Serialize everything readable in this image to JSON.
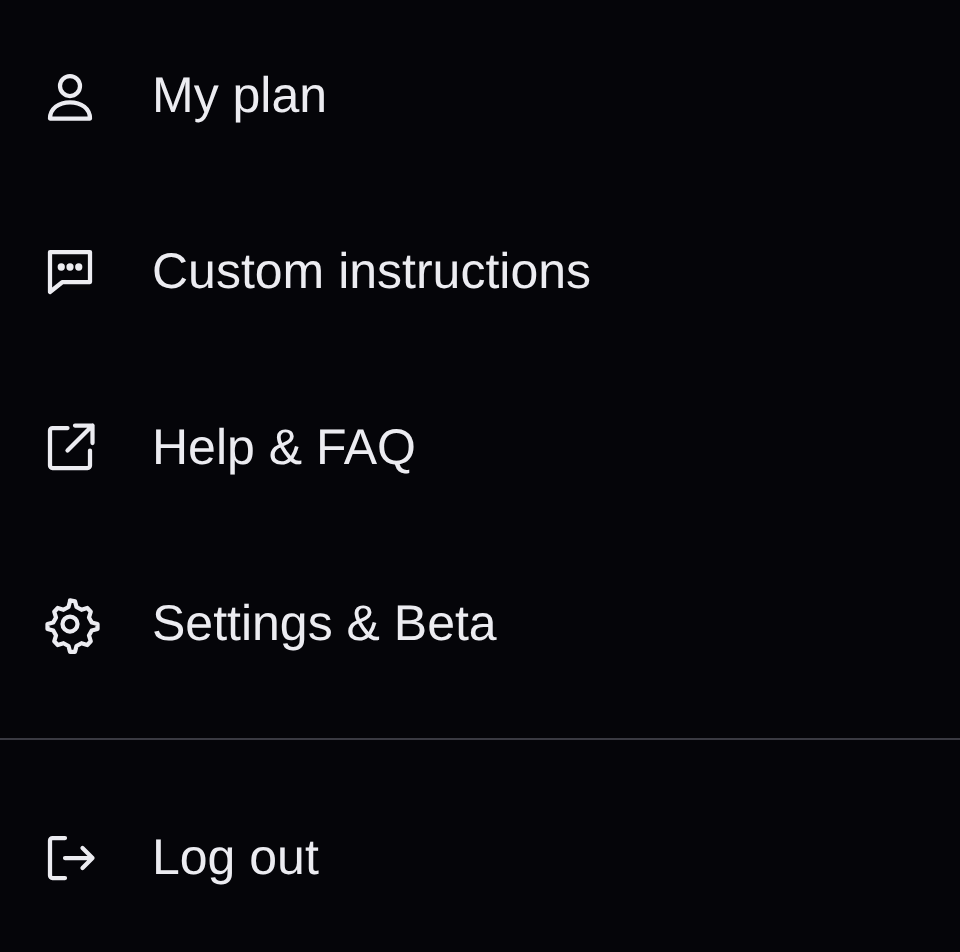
{
  "menu": {
    "items": [
      {
        "kind": "user",
        "label": "My plan"
      },
      {
        "kind": "chat",
        "label": "Custom instructions"
      },
      {
        "kind": "external",
        "label": "Help & FAQ"
      },
      {
        "kind": "gear",
        "label": "Settings & Beta"
      }
    ],
    "footer": [
      {
        "kind": "logout",
        "label": "Log out"
      }
    ]
  }
}
